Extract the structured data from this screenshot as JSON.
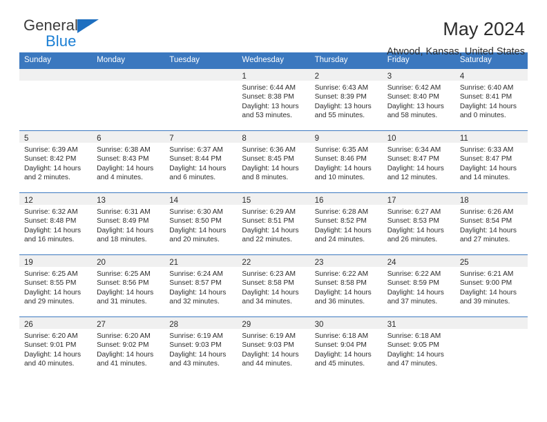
{
  "brand": {
    "name_top": "General",
    "name_bottom": "Blue",
    "accent_color": "#1b7fd4",
    "triangle_color": "#1e6fc0"
  },
  "header": {
    "title": "May 2024",
    "subtitle": "Atwood, Kansas, United States"
  },
  "theme": {
    "header_row_bg": "#3b78bf",
    "header_row_text": "#ffffff",
    "daynum_band_bg": "#f0f0f0",
    "row_divider": "#3b78bf"
  },
  "weekdays": [
    "Sunday",
    "Monday",
    "Tuesday",
    "Wednesday",
    "Thursday",
    "Friday",
    "Saturday"
  ],
  "labels": {
    "sunrise_prefix": "Sunrise:",
    "sunset_prefix": "Sunset:",
    "daylight_prefix": "Daylight:"
  },
  "weeks": [
    [
      {
        "day": "",
        "empty": true
      },
      {
        "day": "",
        "empty": true
      },
      {
        "day": "",
        "empty": true
      },
      {
        "day": "1",
        "sunrise": "Sunrise: 6:44 AM",
        "sunset": "Sunset: 8:38 PM",
        "daylight": "Daylight: 13 hours and 53 minutes."
      },
      {
        "day": "2",
        "sunrise": "Sunrise: 6:43 AM",
        "sunset": "Sunset: 8:39 PM",
        "daylight": "Daylight: 13 hours and 55 minutes."
      },
      {
        "day": "3",
        "sunrise": "Sunrise: 6:42 AM",
        "sunset": "Sunset: 8:40 PM",
        "daylight": "Daylight: 13 hours and 58 minutes."
      },
      {
        "day": "4",
        "sunrise": "Sunrise: 6:40 AM",
        "sunset": "Sunset: 8:41 PM",
        "daylight": "Daylight: 14 hours and 0 minutes."
      }
    ],
    [
      {
        "day": "5",
        "sunrise": "Sunrise: 6:39 AM",
        "sunset": "Sunset: 8:42 PM",
        "daylight": "Daylight: 14 hours and 2 minutes."
      },
      {
        "day": "6",
        "sunrise": "Sunrise: 6:38 AM",
        "sunset": "Sunset: 8:43 PM",
        "daylight": "Daylight: 14 hours and 4 minutes."
      },
      {
        "day": "7",
        "sunrise": "Sunrise: 6:37 AM",
        "sunset": "Sunset: 8:44 PM",
        "daylight": "Daylight: 14 hours and 6 minutes."
      },
      {
        "day": "8",
        "sunrise": "Sunrise: 6:36 AM",
        "sunset": "Sunset: 8:45 PM",
        "daylight": "Daylight: 14 hours and 8 minutes."
      },
      {
        "day": "9",
        "sunrise": "Sunrise: 6:35 AM",
        "sunset": "Sunset: 8:46 PM",
        "daylight": "Daylight: 14 hours and 10 minutes."
      },
      {
        "day": "10",
        "sunrise": "Sunrise: 6:34 AM",
        "sunset": "Sunset: 8:47 PM",
        "daylight": "Daylight: 14 hours and 12 minutes."
      },
      {
        "day": "11",
        "sunrise": "Sunrise: 6:33 AM",
        "sunset": "Sunset: 8:47 PM",
        "daylight": "Daylight: 14 hours and 14 minutes."
      }
    ],
    [
      {
        "day": "12",
        "sunrise": "Sunrise: 6:32 AM",
        "sunset": "Sunset: 8:48 PM",
        "daylight": "Daylight: 14 hours and 16 minutes."
      },
      {
        "day": "13",
        "sunrise": "Sunrise: 6:31 AM",
        "sunset": "Sunset: 8:49 PM",
        "daylight": "Daylight: 14 hours and 18 minutes."
      },
      {
        "day": "14",
        "sunrise": "Sunrise: 6:30 AM",
        "sunset": "Sunset: 8:50 PM",
        "daylight": "Daylight: 14 hours and 20 minutes."
      },
      {
        "day": "15",
        "sunrise": "Sunrise: 6:29 AM",
        "sunset": "Sunset: 8:51 PM",
        "daylight": "Daylight: 14 hours and 22 minutes."
      },
      {
        "day": "16",
        "sunrise": "Sunrise: 6:28 AM",
        "sunset": "Sunset: 8:52 PM",
        "daylight": "Daylight: 14 hours and 24 minutes."
      },
      {
        "day": "17",
        "sunrise": "Sunrise: 6:27 AM",
        "sunset": "Sunset: 8:53 PM",
        "daylight": "Daylight: 14 hours and 26 minutes."
      },
      {
        "day": "18",
        "sunrise": "Sunrise: 6:26 AM",
        "sunset": "Sunset: 8:54 PM",
        "daylight": "Daylight: 14 hours and 27 minutes."
      }
    ],
    [
      {
        "day": "19",
        "sunrise": "Sunrise: 6:25 AM",
        "sunset": "Sunset: 8:55 PM",
        "daylight": "Daylight: 14 hours and 29 minutes."
      },
      {
        "day": "20",
        "sunrise": "Sunrise: 6:25 AM",
        "sunset": "Sunset: 8:56 PM",
        "daylight": "Daylight: 14 hours and 31 minutes."
      },
      {
        "day": "21",
        "sunrise": "Sunrise: 6:24 AM",
        "sunset": "Sunset: 8:57 PM",
        "daylight": "Daylight: 14 hours and 32 minutes."
      },
      {
        "day": "22",
        "sunrise": "Sunrise: 6:23 AM",
        "sunset": "Sunset: 8:58 PM",
        "daylight": "Daylight: 14 hours and 34 minutes."
      },
      {
        "day": "23",
        "sunrise": "Sunrise: 6:22 AM",
        "sunset": "Sunset: 8:58 PM",
        "daylight": "Daylight: 14 hours and 36 minutes."
      },
      {
        "day": "24",
        "sunrise": "Sunrise: 6:22 AM",
        "sunset": "Sunset: 8:59 PM",
        "daylight": "Daylight: 14 hours and 37 minutes."
      },
      {
        "day": "25",
        "sunrise": "Sunrise: 6:21 AM",
        "sunset": "Sunset: 9:00 PM",
        "daylight": "Daylight: 14 hours and 39 minutes."
      }
    ],
    [
      {
        "day": "26",
        "sunrise": "Sunrise: 6:20 AM",
        "sunset": "Sunset: 9:01 PM",
        "daylight": "Daylight: 14 hours and 40 minutes."
      },
      {
        "day": "27",
        "sunrise": "Sunrise: 6:20 AM",
        "sunset": "Sunset: 9:02 PM",
        "daylight": "Daylight: 14 hours and 41 minutes."
      },
      {
        "day": "28",
        "sunrise": "Sunrise: 6:19 AM",
        "sunset": "Sunset: 9:03 PM",
        "daylight": "Daylight: 14 hours and 43 minutes."
      },
      {
        "day": "29",
        "sunrise": "Sunrise: 6:19 AM",
        "sunset": "Sunset: 9:03 PM",
        "daylight": "Daylight: 14 hours and 44 minutes."
      },
      {
        "day": "30",
        "sunrise": "Sunrise: 6:18 AM",
        "sunset": "Sunset: 9:04 PM",
        "daylight": "Daylight: 14 hours and 45 minutes."
      },
      {
        "day": "31",
        "sunrise": "Sunrise: 6:18 AM",
        "sunset": "Sunset: 9:05 PM",
        "daylight": "Daylight: 14 hours and 47 minutes."
      },
      {
        "day": "",
        "empty": true
      }
    ]
  ]
}
